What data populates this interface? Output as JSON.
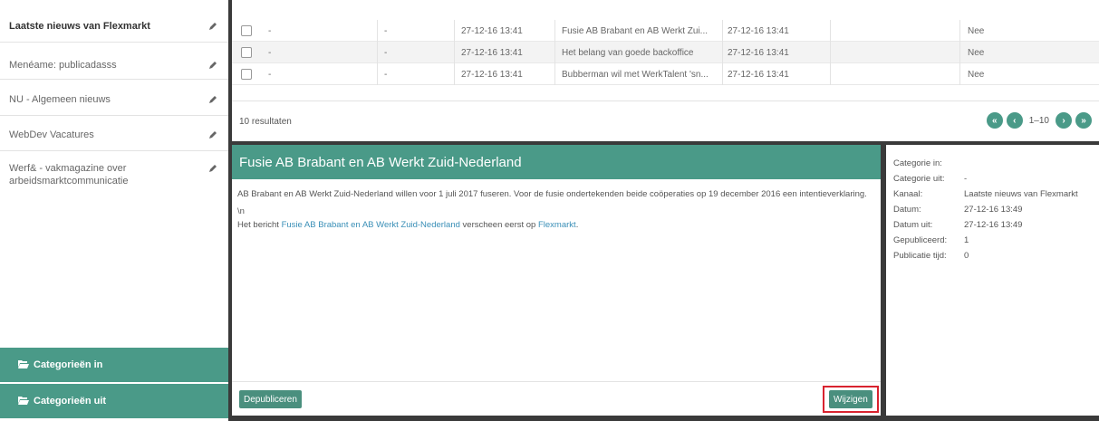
{
  "sidebar": {
    "items": [
      {
        "label": "Laatste nieuws van Flexmarkt",
        "active": true
      },
      {
        "label": "Menéame: publicadasss"
      },
      {
        "label": "NU - Algemeen nieuws"
      },
      {
        "label": "WebDev Vacatures"
      },
      {
        "label": "Werf& - vakmagazine over arbeidsmarktcommunicatie"
      }
    ],
    "cat_in": "Categorieën in",
    "cat_out": "Categorieën uit"
  },
  "table": {
    "rows": [
      {
        "c1": "-",
        "c2": "-",
        "date": "27-12-16 13:41",
        "title": "Fusie AB Brabant en AB Werkt Zui...",
        "date2": "27-12-16 13:41",
        "pub": "Nee"
      },
      {
        "c1": "-",
        "c2": "-",
        "date": "27-12-16 13:41",
        "title": "Het belang van goede backoffice",
        "date2": "27-12-16 13:41",
        "pub": "Nee"
      },
      {
        "c1": "-",
        "c2": "-",
        "date": "27-12-16 13:41",
        "title": "Bubberman wil met WerkTalent 'sn...",
        "date2": "27-12-16 13:41",
        "pub": "Nee"
      }
    ],
    "results": "10 resultaten",
    "pager": {
      "first": "«",
      "prev": "‹",
      "range": "1–10",
      "next": "›",
      "last": "»"
    }
  },
  "detail": {
    "title": "Fusie AB Brabant en AB Werkt Zuid-Nederland",
    "body": "AB Brabant en AB Werkt Zuid-Nederland willen voor 1 juli 2017 fuseren. Voor de fusie ondertekenden beide coöperaties op 19 december 2016 een intentieverklaring.",
    "escape": "\\n",
    "posted_prefix": "Het bericht ",
    "posted_link": "Fusie AB Brabant en AB Werkt Zuid-Nederland",
    "posted_mid": " verscheen eerst op ",
    "posted_site": "Flexmarkt",
    "posted_end": ".",
    "depublish": "Depubliceren",
    "edit": "Wijzigen"
  },
  "meta": {
    "rows": [
      {
        "k": "Categorie in:",
        "v": ""
      },
      {
        "k": "Categorie uit:",
        "v": "-"
      },
      {
        "k": "Kanaal:",
        "v": "Laatste nieuws van Flexmarkt"
      },
      {
        "k": "Datum:",
        "v": "27-12-16 13:49"
      },
      {
        "k": "Datum uit:",
        "v": "27-12-16 13:49"
      },
      {
        "k": "Gepubliceerd:",
        "v": "1"
      },
      {
        "k": "Publicatie tijd:",
        "v": "0"
      }
    ]
  },
  "colors": {
    "accent": "#4a9a88",
    "link": "#3a8fb7",
    "highlight": "#d9232f"
  }
}
